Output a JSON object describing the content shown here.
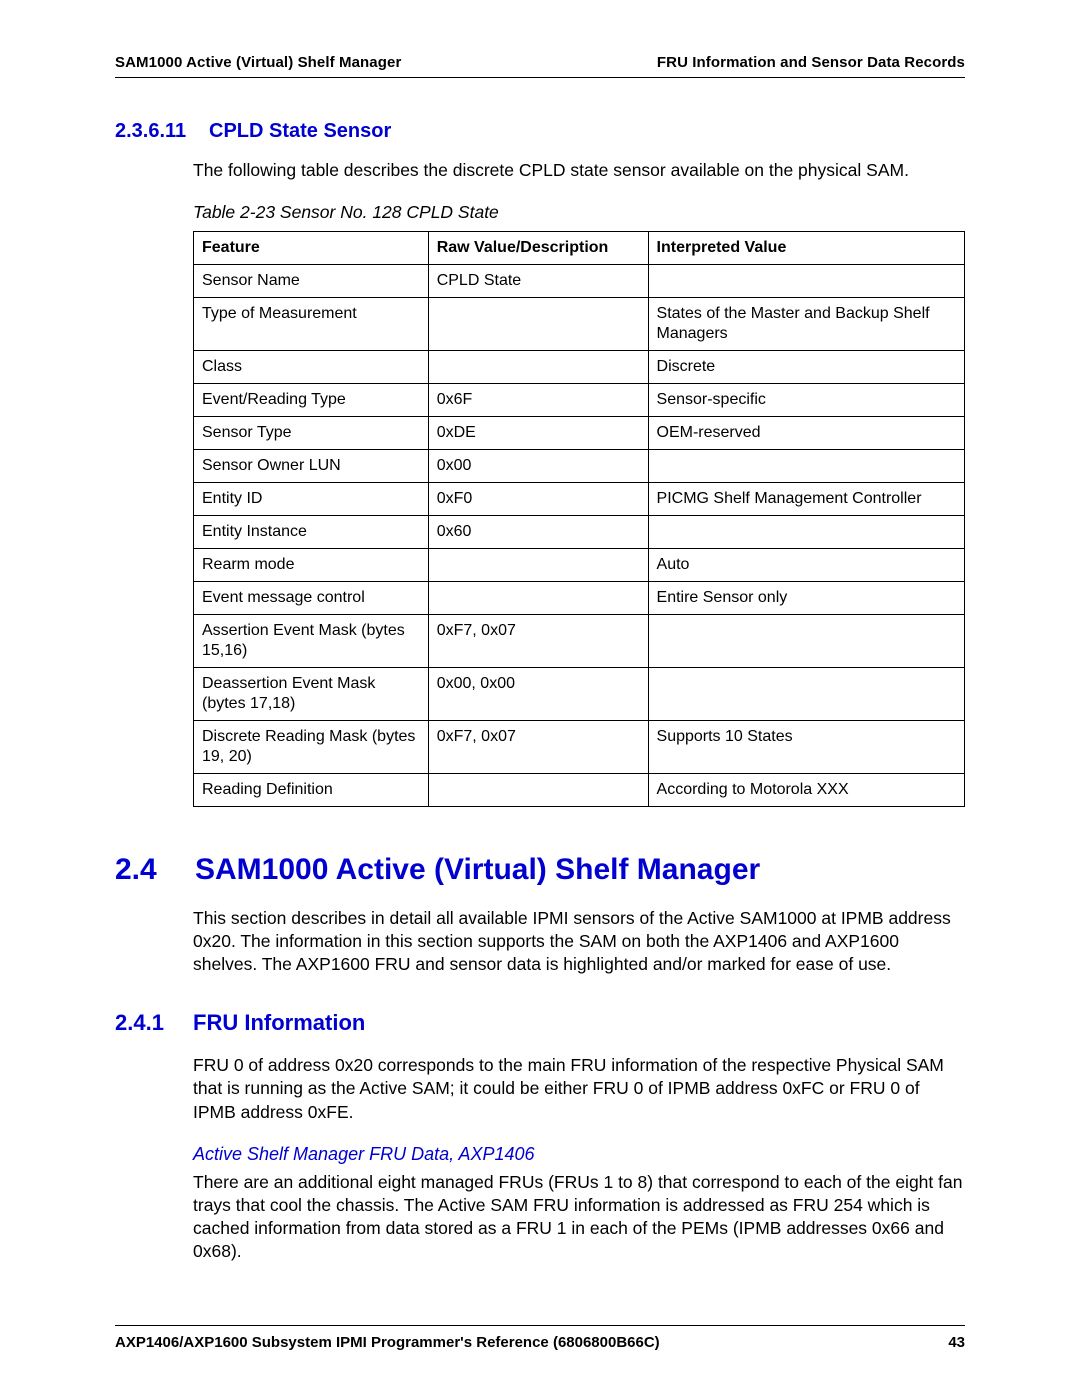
{
  "header": {
    "left": "SAM1000 Active (Virtual) Shelf Manager",
    "right": "FRU Information and Sensor Data Records"
  },
  "sec_23611": {
    "num": "2.3.6.11",
    "title": "CPLD State Sensor",
    "intro": "The following table describes the discrete CPLD state sensor available on the physical SAM.",
    "table_caption": "Table 2-23 Sensor No. 128 CPLD State",
    "columns": {
      "c1": "Feature",
      "c2": "Raw Value/Description",
      "c3": "Interpreted Value"
    },
    "rows": [
      {
        "feature": "Sensor Name",
        "raw": "CPLD State",
        "interp": ""
      },
      {
        "feature": "Type of Measurement",
        "raw": "",
        "interp": "States of the Master and Backup Shelf Managers"
      },
      {
        "feature": "Class",
        "raw": "",
        "interp": "Discrete"
      },
      {
        "feature": "Event/Reading Type",
        "raw": "0x6F",
        "interp": "Sensor-specific"
      },
      {
        "feature": "Sensor Type",
        "raw": "0xDE",
        "interp": "OEM-reserved"
      },
      {
        "feature": "Sensor Owner LUN",
        "raw": "0x00",
        "interp": ""
      },
      {
        "feature": "Entity ID",
        "raw": "0xF0",
        "interp": "PICMG Shelf Management Controller"
      },
      {
        "feature": "Entity Instance",
        "raw": "0x60",
        "interp": ""
      },
      {
        "feature": "Rearm mode",
        "raw": "",
        "interp": "Auto"
      },
      {
        "feature": "Event message control",
        "raw": "",
        "interp": "Entire Sensor only"
      },
      {
        "feature": "Assertion Event Mask (bytes 15,16)",
        "raw": "0xF7, 0x07",
        "interp": ""
      },
      {
        "feature": "Deassertion Event Mask (bytes 17,18)",
        "raw": "0x00, 0x00",
        "interp": ""
      },
      {
        "feature": "Discrete Reading Mask (bytes 19, 20)",
        "raw": "0xF7, 0x07",
        "interp": "Supports 10 States"
      },
      {
        "feature": "Reading Definition",
        "raw": "",
        "interp": "According to Motorola XXX"
      }
    ]
  },
  "sec_24": {
    "num": "2.4",
    "title": "SAM1000 Active (Virtual) Shelf Manager",
    "body": "This section describes in detail all available IPMI sensors of the Active SAM1000 at IPMB address 0x20. The information in this section supports the SAM on both the AXP1406 and AXP1600 shelves. The AXP1600 FRU and sensor data is highlighted and/or marked for ease of use."
  },
  "sec_241": {
    "num": "2.4.1",
    "title": "FRU Information",
    "p1": "FRU 0 of address 0x20 corresponds to the main FRU information of the respective Physical SAM that is running as the Active SAM; it could be either FRU 0 of IPMB address 0xFC or FRU 0 of IPMB address 0xFE.",
    "subhead": "Active Shelf Manager FRU Data, AXP1406",
    "p2": "There are an additional eight managed FRUs (FRUs 1 to 8) that correspond to each of the eight fan trays that cool the chassis. The Active SAM FRU information is addressed as FRU 254 which is cached information from data stored as a FRU 1 in each of the PEMs (IPMB addresses 0x66 and 0x68)."
  },
  "footer": {
    "left": "AXP1406/AXP1600 Subsystem IPMI Programmer's Reference (6806800B66C)",
    "right": "43"
  }
}
